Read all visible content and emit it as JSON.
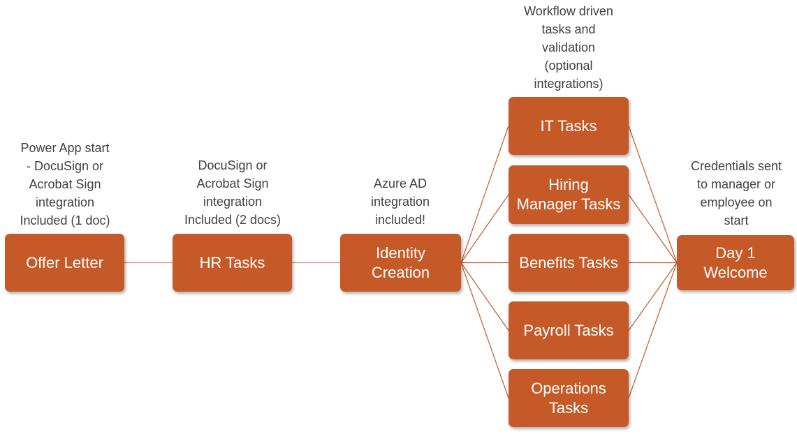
{
  "colors": {
    "box": "#C55A28",
    "connector": "#C55A28",
    "box_text": "#FFFFFF",
    "note_text": "#404040"
  },
  "nodes": {
    "offer_letter": {
      "label": [
        "Offer Letter"
      ],
      "note": [
        "Power App start",
        "- DocuSign or",
        "Acrobat Sign",
        "integration",
        "Included (1 doc)"
      ]
    },
    "hr_tasks": {
      "label": [
        "HR Tasks"
      ],
      "note": [
        "DocuSign or",
        "Acrobat Sign",
        "integration",
        "Included (2 docs)"
      ]
    },
    "identity_creation": {
      "label": [
        "Identity",
        "Creation"
      ],
      "note": [
        "Azure AD",
        "integration",
        "included!"
      ]
    },
    "it_tasks": {
      "label": [
        "IT Tasks"
      ],
      "note": [
        "Workflow driven",
        "tasks and",
        "validation",
        "(optional",
        "integrations)"
      ]
    },
    "hiring_manager_tasks": {
      "label": [
        "Hiring",
        "Manager Tasks"
      ]
    },
    "benefits_tasks": {
      "label": [
        "Benefits Tasks"
      ]
    },
    "payroll_tasks": {
      "label": [
        "Payroll Tasks"
      ]
    },
    "operations_tasks": {
      "label": [
        "Operations",
        "Tasks"
      ]
    },
    "day1_welcome": {
      "label": [
        "Day 1",
        "Welcome"
      ],
      "note": [
        "Credentials sent",
        "to manager or",
        "employee on",
        "start"
      ]
    }
  },
  "edges": [
    [
      "offer_letter",
      "hr_tasks"
    ],
    [
      "hr_tasks",
      "identity_creation"
    ],
    [
      "identity_creation",
      "it_tasks"
    ],
    [
      "identity_creation",
      "hiring_manager_tasks"
    ],
    [
      "identity_creation",
      "benefits_tasks"
    ],
    [
      "identity_creation",
      "payroll_tasks"
    ],
    [
      "identity_creation",
      "operations_tasks"
    ],
    [
      "it_tasks",
      "day1_welcome"
    ],
    [
      "hiring_manager_tasks",
      "day1_welcome"
    ],
    [
      "benefits_tasks",
      "day1_welcome"
    ],
    [
      "payroll_tasks",
      "day1_welcome"
    ],
    [
      "operations_tasks",
      "day1_welcome"
    ]
  ]
}
